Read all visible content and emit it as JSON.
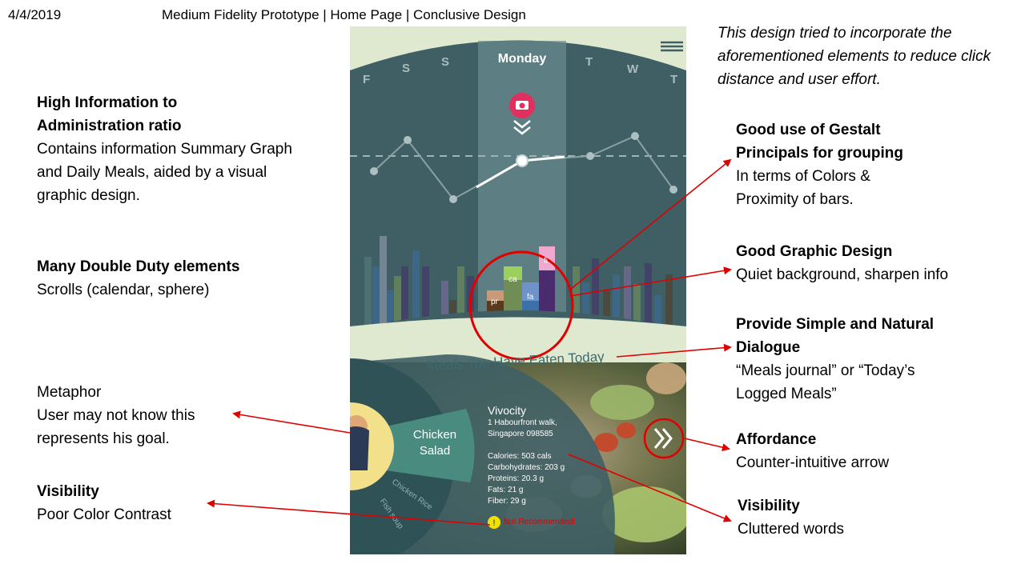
{
  "header": {
    "date": "4/4/2019",
    "title": "Medium Fidelity Prototype | Home Page | Conclusive Design"
  },
  "intro_text": "This design tried to incorporate the aforementioned elements to reduce click distance and user effort.",
  "left_notes": [
    {
      "title": "High Information to Administration ratio",
      "body": "Contains information Summary Graph and Daily Meals, aided by a visual graphic design."
    },
    {
      "title": "Many Double Duty elements",
      "body": "Scrolls (calendar, sphere)"
    },
    {
      "title": "Metaphor",
      "body": "User may not know this represents his goal."
    },
    {
      "title": "Visibility",
      "body": "Poor Color Contrast"
    }
  ],
  "right_notes": [
    {
      "title": "Good use of Gestalt Principals for grouping",
      "body": "In terms of Colors & Proximity of bars."
    },
    {
      "title": "Good Graphic Design",
      "body": "Quiet background, sharpen info"
    },
    {
      "title": "Provide Simple and Natural Dialogue",
      "body": "“Meals journal” or “Today’s Logged Meals”"
    },
    {
      "title": "Affordance",
      "body": "Counter-intuitive arrow"
    },
    {
      "title": "Visibility",
      "body": "Cluttered words"
    }
  ],
  "app": {
    "selected_day": "Monday",
    "days": [
      "F",
      "S",
      "S",
      "T",
      "W",
      "T"
    ],
    "bar_labels": [
      "pr",
      "ca",
      "fa",
      "fi"
    ],
    "meals_heading": "Meals You Have Eaten Today",
    "meal_selected": "Chicken Salad",
    "meal_others": [
      "Chicken Rice",
      "Fish soup"
    ],
    "restaurant": {
      "name": "Vivocity",
      "address_line1": "1 Habourfront walk,",
      "address_line2": "Singapore 098585"
    },
    "nutrition": [
      "Calories: 503 cals",
      "Carbohydrates: 203 g",
      "Proteins: 20.3 g",
      "Fats: 21 g",
      "Fiber: 29 g"
    ],
    "warning": "Not Recommended!",
    "icons": [
      "menu-icon",
      "camera-icon",
      "chevron-down-icon",
      "double-chevron-right-icon",
      "warning-icon",
      "avatar"
    ],
    "colors": {
      "protein": "#5a3a1e",
      "carbs": "#7a9a5a",
      "fats": "#3d6fa8",
      "fiber": "#4a2c6e",
      "accent": "#e03060",
      "annotation": "#e00000"
    }
  }
}
